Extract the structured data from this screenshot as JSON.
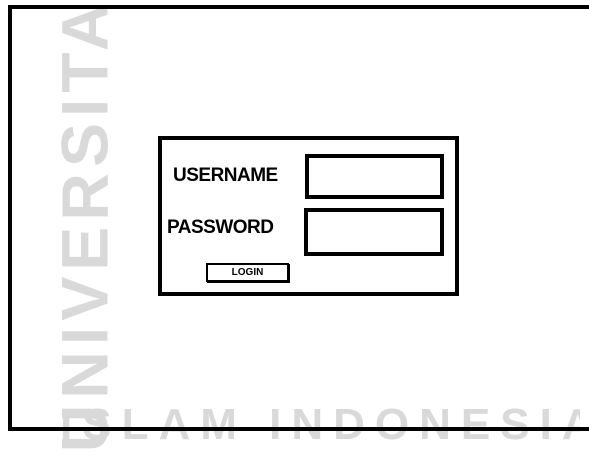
{
  "login": {
    "username_label": "USERNAME",
    "password_label": "PASSWORD",
    "username_value": "",
    "password_value": "",
    "login_button_label": "LOGIN"
  },
  "watermark": {
    "vertical_text": "UNIVERSITAS",
    "bottom_text": "ISLAM INDONESIA"
  },
  "colors": {
    "border": "#000000",
    "background": "#ffffff",
    "watermark": "#d9d9d9"
  }
}
